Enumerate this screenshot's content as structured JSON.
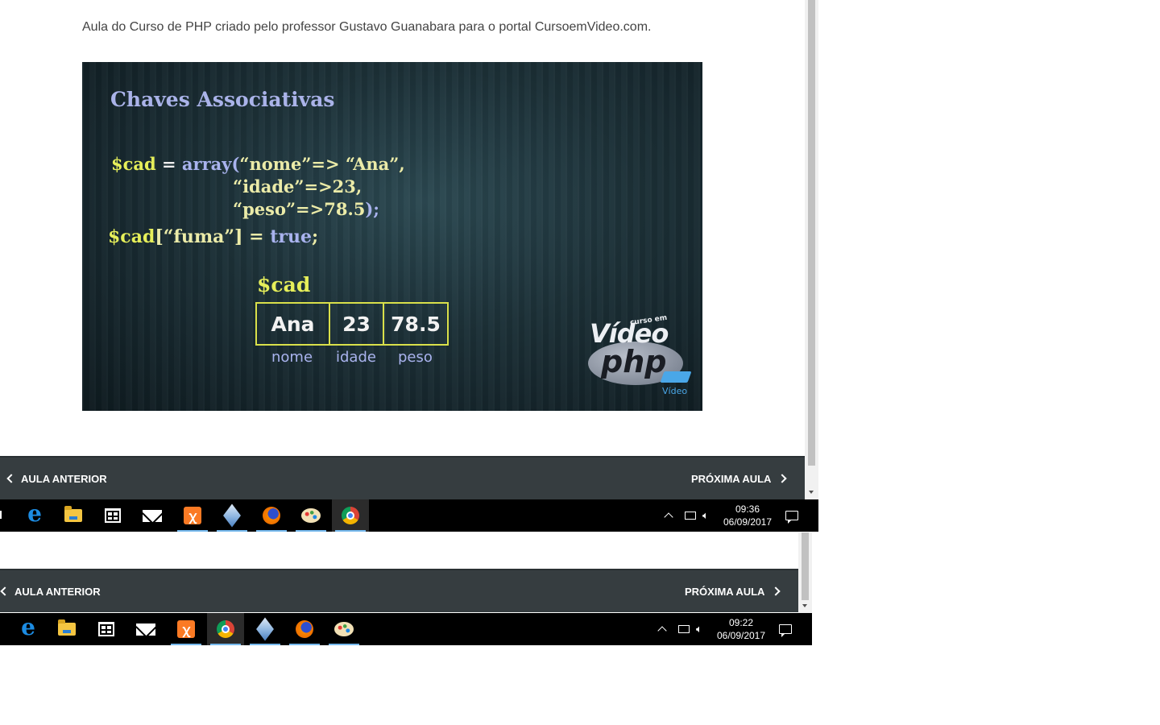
{
  "article": {
    "intro_text": "Aula do Curso de PHP criado pelo professor Gustavo Guanabara para o portal CursoemVideo.com."
  },
  "video": {
    "slide_title": "Chaves Associativas",
    "code_line1": {
      "var": "$cad",
      "eq": " = ",
      "fn": "array(",
      "str": "“nome”=> “Ana”,"
    },
    "code_line2": "“idade”=>23,",
    "code_line3": {
      "str": "“peso”=>78.5",
      "close": ");"
    },
    "code_line4": {
      "var": "$cad",
      "bracket": "[“fuma”] = ",
      "bool": "true",
      "semi": ";"
    },
    "array_label": "$cad",
    "cells": [
      "Ana",
      "23",
      "78.5"
    ],
    "keys": [
      "nome",
      "idade",
      "peso"
    ],
    "logo": {
      "curso": "curso em",
      "video": "Vídeo",
      "php": "php",
      "sub": "Vídeo"
    }
  },
  "nav": {
    "prev_label": "AULA ANTERIOR",
    "next_label": "PRÓXIMA AULA"
  },
  "taskbar_top": {
    "time": "09:36",
    "date": "06/09/2017",
    "apps": [
      "edge-icon",
      "file-explorer-icon",
      "store-icon",
      "mail-icon",
      "xampp-icon",
      "virtualbox-icon",
      "firefox-icon",
      "paint-icon",
      "chrome-icon"
    ]
  },
  "taskbar_bottom": {
    "time": "09:22",
    "date": "06/09/2017",
    "apps": [
      "edge-icon",
      "file-explorer-icon",
      "store-icon",
      "mail-icon",
      "xampp-icon",
      "chrome-icon",
      "virtualbox-icon",
      "firefox-icon",
      "paint-icon"
    ]
  },
  "colors": {
    "navbar": "#363d40",
    "taskbar": "#000000",
    "accent_underline": "#76b9ed",
    "slide_yellow": "#e6ef5a",
    "slide_blue": "#a9b3ee"
  }
}
